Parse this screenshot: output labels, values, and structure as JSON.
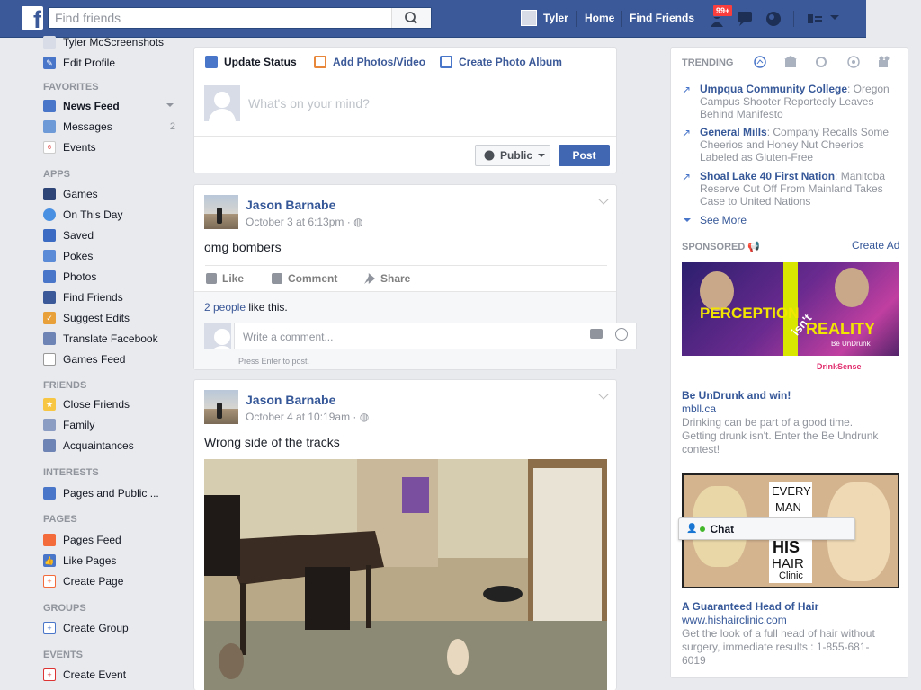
{
  "topbar": {
    "search_placeholder": "Find friends",
    "user_name": "Tyler",
    "home_label": "Home",
    "find_friends_label": "Find Friends",
    "notif_badge": "99+",
    "brand_color": "#3b5998"
  },
  "sidebar": {
    "profile_name": "Tyler McScreenshots",
    "edit_profile": "Edit Profile",
    "sections": {
      "favorites": "FAVORITES",
      "apps": "APPS",
      "friends": "FRIENDS",
      "interests": "INTERESTS",
      "pages": "PAGES",
      "groups": "GROUPS",
      "events": "EVENTS"
    },
    "favorites": [
      {
        "label": "News Feed",
        "icon": "news-feed-icon"
      },
      {
        "label": "Messages",
        "icon": "messages-icon",
        "count": "2"
      },
      {
        "label": "Events",
        "icon": "events-icon"
      }
    ],
    "apps": [
      {
        "label": "Games",
        "icon": "games-icon"
      },
      {
        "label": "On This Day",
        "icon": "on-this-day-icon"
      },
      {
        "label": "Saved",
        "icon": "saved-icon"
      },
      {
        "label": "Pokes",
        "icon": "pokes-icon"
      },
      {
        "label": "Photos",
        "icon": "photos-icon"
      },
      {
        "label": "Find Friends",
        "icon": "find-friends-icon"
      },
      {
        "label": "Suggest Edits",
        "icon": "suggest-edits-icon"
      },
      {
        "label": "Translate Facebook",
        "icon": "translate-icon"
      },
      {
        "label": "Games Feed",
        "icon": "games-feed-icon"
      }
    ],
    "friends": [
      {
        "label": "Close Friends",
        "icon": "star-icon"
      },
      {
        "label": "Family",
        "icon": "family-icon"
      },
      {
        "label": "Acquaintances",
        "icon": "acquaintances-icon"
      }
    ],
    "interests": [
      {
        "label": "Pages and Public ...",
        "icon": "pages-public-icon"
      }
    ],
    "pages": [
      {
        "label": "Pages Feed",
        "icon": "pages-feed-icon"
      },
      {
        "label": "Like Pages",
        "icon": "like-pages-icon"
      },
      {
        "label": "Create Page",
        "icon": "create-page-icon"
      }
    ],
    "groups": [
      {
        "label": "Create Group",
        "icon": "create-group-icon"
      }
    ],
    "events": [
      {
        "label": "Create Event",
        "icon": "create-event-icon"
      }
    ]
  },
  "composer": {
    "tabs": [
      "Update Status",
      "Add Photos/Video",
      "Create Photo Album"
    ],
    "placeholder": "What's on your mind?",
    "privacy": "Public",
    "post_label": "Post"
  },
  "posts": [
    {
      "author": "Jason Barnabe",
      "time": "October 3 at 6:13pm ·",
      "text": "omg bombers",
      "actions": [
        "Like",
        "Comment",
        "Share"
      ],
      "likes_link": "2 people",
      "likes_rest": "like this.",
      "comment_placeholder": "Write a comment...",
      "hint": "Press Enter to post."
    },
    {
      "author": "Jason Barnabe",
      "time": "October 4 at 10:19am ·",
      "text": "Wrong side of the tracks"
    }
  ],
  "right": {
    "trending_label": "TRENDING",
    "trends": [
      {
        "title": "Umpqua Community College",
        "desc": ": Oregon Campus Shooter Reportedly Leaves Behind Manifesto"
      },
      {
        "title": "General Mills",
        "desc": ": Company Recalls Some Cheerios and Honey Nut Cheerios Labeled as Gluten-Free"
      },
      {
        "title": "Shoal Lake 40 First Nation",
        "desc": ": Manitoba Reserve Cut Off From Mainland Takes Case to United Nations"
      }
    ],
    "see_more": "See More",
    "sponsored_label": "SPONSORED",
    "create_ad": "Create Ad",
    "ads": [
      {
        "banner_text_1": "PERCEPTION",
        "banner_text_2": "isn't",
        "banner_text_3": "REALITY",
        "banner_sub": "Be UnDrunk",
        "banner_brand": "DrinkSense",
        "title": "Be UnDrunk and win!",
        "url": "mbll.ca",
        "desc": "Drinking can be part of a good time. Getting drunk isn't. Enter the Be Undrunk contest!"
      },
      {
        "banner_text_1": "EVERY",
        "banner_text_2": "MAN",
        "banner_text_3": "HIS",
        "banner_text_4": "HAIR",
        "banner_text_5": "Clinic",
        "title": "A Guaranteed Head of Hair",
        "url": "www.hishairclinic.com",
        "desc": "Get the look of a full head of hair without surgery, immediate results : 1-855-681-6019"
      }
    ]
  },
  "chat": {
    "label": "Chat"
  }
}
